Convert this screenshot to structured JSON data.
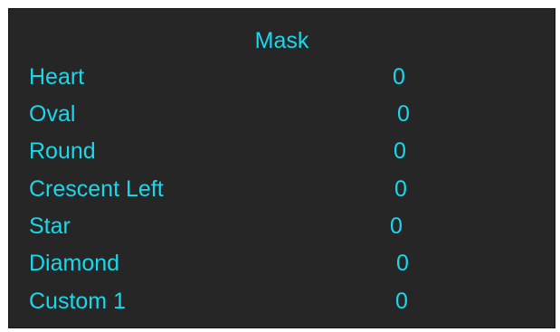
{
  "menu": {
    "title": "Mask",
    "items": [
      {
        "label": "Heart",
        "value": "0"
      },
      {
        "label": "Oval",
        "value": "0"
      },
      {
        "label": "Round",
        "value": "0"
      },
      {
        "label": "Crescent Left",
        "value": "0"
      },
      {
        "label": "Star",
        "value": "0"
      },
      {
        "label": "Diamond",
        "value": "0"
      },
      {
        "label": "Custom 1",
        "value": "0"
      }
    ]
  },
  "colors": {
    "background": "#262626",
    "text": "#18d8ec"
  }
}
